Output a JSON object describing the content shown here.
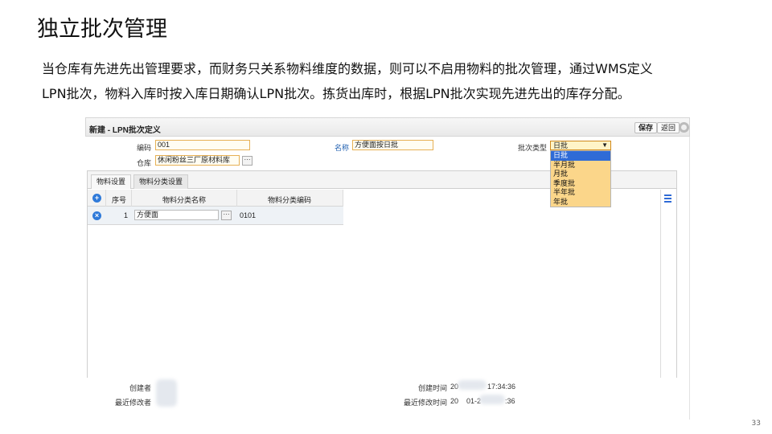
{
  "slide": {
    "title": "独立批次管理",
    "paragraph_line1": "当仓库有先进先出管理要求，而财务只关系物料维度的数据，则可以不启用物料的批次管理，通过WMS定义",
    "paragraph_line2": "LPN批次，物料入库时按入库日期确认LPN批次。拣货出库时，根据LPN批次实现先进先出的库存分配。",
    "page_number": "33"
  },
  "app": {
    "window_title": "新建 - LPN批次定义",
    "toolbar": {
      "save_label": "保存",
      "back_label": "返回"
    },
    "form": {
      "code_label": "编码",
      "code_value": "001",
      "warehouse_label": "仓库",
      "warehouse_value": "休闲粉丝三厂原材料库",
      "name_label": "名称",
      "name_value": "方便面按日批",
      "batch_type_label": "批次类型",
      "batch_type_value": "日批",
      "batch_type_options": [
        "日批",
        "半月批",
        "月批",
        "季度批",
        "半年批",
        "年批"
      ]
    },
    "tabs": [
      "物料设置",
      "物料分类设置"
    ],
    "grid": {
      "headers": {
        "seq": "序号",
        "category_name": "物料分类名称",
        "category_code": "物料分类编码"
      },
      "rows": [
        {
          "seq": "1",
          "category_name": "方便面",
          "category_code": "0101"
        }
      ]
    },
    "footer": {
      "creator_label": "创建者",
      "modifier_label": "最近修改者",
      "created_time_label": "创建时间",
      "created_time_value_start": "20",
      "created_time_value_end": "17:34:36",
      "modified_time_label": "最近修改时间",
      "modified_time_value_start": "20",
      "modified_time_value_mid": "01-2",
      "modified_time_value_end": ":36"
    }
  }
}
